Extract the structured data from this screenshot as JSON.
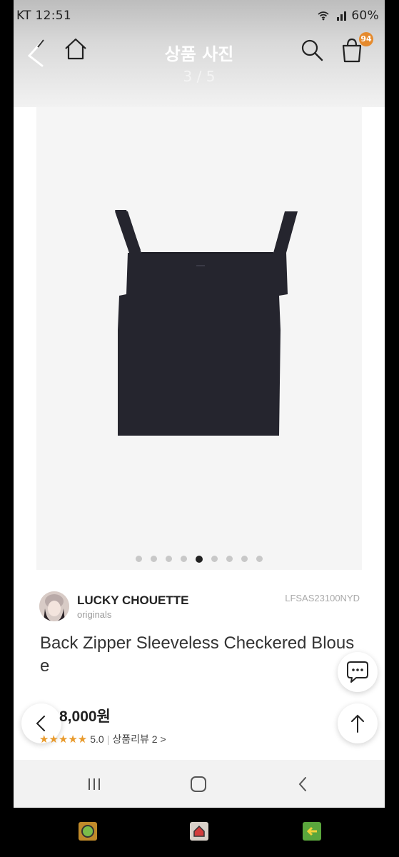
{
  "status_bar": {
    "left_text": "KT 12:51",
    "right_text": "60%"
  },
  "header": {
    "title": "상품 사진",
    "counter": "3 / 5",
    "cart_badge": "94"
  },
  "carousel": {
    "total_dots": 9,
    "active_index": 4
  },
  "brand": {
    "name": "LUCKY CHOUETTE",
    "subtitle": "originals",
    "product_code": "LFSAS23100NYD"
  },
  "product": {
    "name": "Back Zipper Sleeveless Checkered Blouse",
    "price": "8,000원",
    "stars": "★★★★★",
    "rating": "5.0",
    "rating_separator": "|",
    "review_link": "상품리뷰 2 >"
  },
  "icons": {
    "back": "chevron-left-icon",
    "home": "home-icon",
    "search": "search-icon",
    "cart": "shopping-bag-icon",
    "chat": "chat-bubble-icon",
    "top": "arrow-up-icon",
    "prev": "chevron-left-icon"
  },
  "colors": {
    "badge": "#e58a2d",
    "stars": "#e89a2c",
    "garment": "#25252e"
  }
}
